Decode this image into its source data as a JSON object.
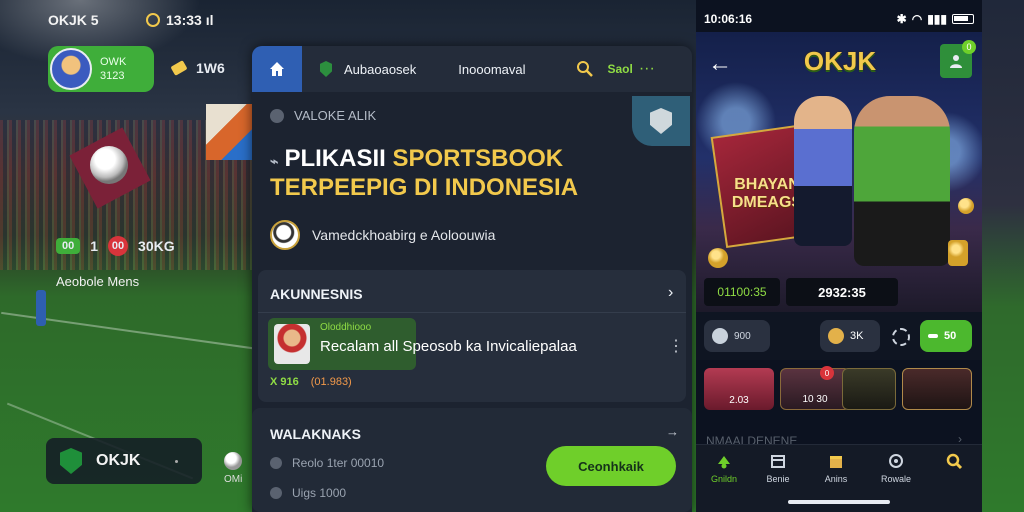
{
  "left": {
    "status_carrier": "OKJK 5",
    "status_time": "13:33 ıl",
    "profile_name": "OWK",
    "profile_sub": "3123",
    "ticket_value": "1W6",
    "score_left": "00",
    "score_mid": "1",
    "score_red": "00",
    "score_right": "30KG",
    "live_label": "Aeobole Mens",
    "brand_name": "OKJK",
    "mini_label": "OMi"
  },
  "panel": {
    "nav_item1": "Aubaoaosek",
    "nav_item2": "Inooomaval",
    "search_text": "Saol",
    "eyebrow": "VALOKE ALIK",
    "headline_white": "PLIKASII ",
    "headline_gold": "SPORTSBOOK",
    "headline_line2": "TERPEEPIG DI INDONESIA",
    "tagline": "Vamedckhoabirg e Aoloouwia",
    "card_title": "AKUNNESNIS",
    "item_tag": "Oloddhiooo",
    "item_title": "Recalam all Speosob ka Invicaliepalaa",
    "item_meta_x": "X 916",
    "item_meta_val": "(01.983)",
    "card2_title": "WALAKNAKS",
    "row1": "Reolo 1ter 00010",
    "row2": "Uigs 1000",
    "cta_label": "Ceonhkaik"
  },
  "phone": {
    "status_time": "10:06:16",
    "logo": "OKJK",
    "notif_count": "0",
    "bonus_line1": "BHAYAN",
    "bonus_line2": "DMEAGS",
    "stat1": "01100:35",
    "stat2": "2932:35",
    "chip1": "900",
    "chip2": "3K",
    "chip3": "50",
    "tile_badge": "0",
    "tile1": "2.03",
    "tile2": "10 30",
    "tile3": "",
    "tile4": "",
    "section_faded": "NMAALDENENE",
    "tabs": [
      {
        "label": "Gnildn",
        "color": "#6fcf2a"
      },
      {
        "label": "Benie",
        "color": "#cfd6e0"
      },
      {
        "label": "Anins",
        "color": "#e3b14a"
      },
      {
        "label": "Rowale",
        "color": "#cfd6e0"
      },
      {
        "label": "",
        "color": "#f2c94c"
      }
    ]
  },
  "colors": {
    "accent_green": "#6fcf2a",
    "gold": "#f2c94c",
    "panel_bg": "#1c2330",
    "nav_blue": "#2f5fb3"
  }
}
